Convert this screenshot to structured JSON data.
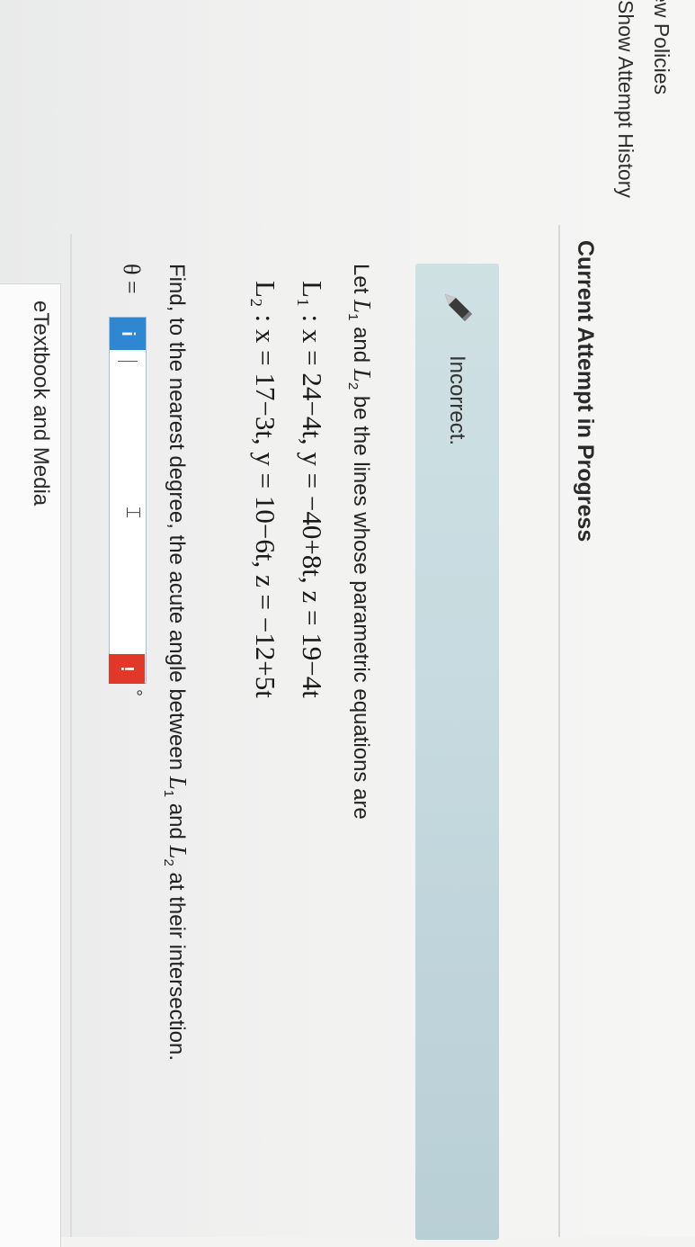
{
  "links": {
    "view_policies": "View Policies",
    "show_attempt_history": "Show Attempt History"
  },
  "attempt": {
    "heading": "Current Attempt in Progress"
  },
  "feedback": {
    "status": "Incorrect.",
    "icon": "pencil-icon"
  },
  "question": {
    "intro_prefix": "Let ",
    "intro_mid": " and ",
    "intro_suffix": " be the lines whose parametric equations are",
    "line1_name": "L",
    "line1_sub": "1",
    "line2_name": "L",
    "line2_sub": "2",
    "equation1": "L₁ : x = 24−4t, y = −40+8t, z = 19−4t",
    "equation2": "L₂ : x = 17−3t, y = 10−6t, z = −12+5t",
    "find_prefix": "Find, to the nearest degree, the acute angle between ",
    "find_mid": " and ",
    "find_suffix": " at their intersection."
  },
  "answer": {
    "label": "θ =",
    "value": "",
    "info_badge": "i",
    "error_badge": "!",
    "unit": "°"
  },
  "footer": {
    "etextbook": "eTextbook and Media"
  },
  "colors": {
    "feedback_bg": "#c7dbe0",
    "info_badge": "#2f86d1",
    "error_badge": "#e2382a"
  }
}
